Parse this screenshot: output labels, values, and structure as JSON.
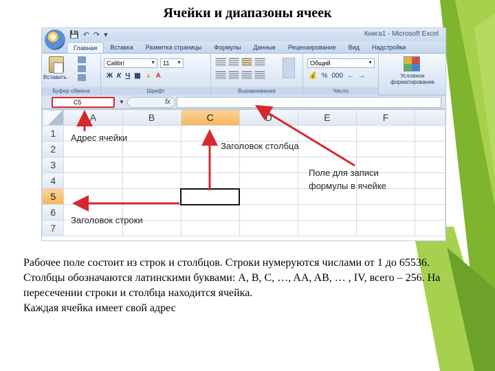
{
  "slide": {
    "title": "Ячейки и диапазоны ячеек",
    "paragraphs": [
      "Рабочее поле состоит из строк и столбцов. Строки нумеруются числами от 1 до 65536.",
      "Столбцы обозначаются латинскими буквами: A, B, C, …, AA, AB, … , IV, всего – 256. На пересечении строки и столбца находится ячейка.",
      "Каждая ячейка имеет свой адрес"
    ],
    "accent_colors": {
      "green_light": "#9ccc3c",
      "green_dark": "#6ea12a",
      "arrow_red": "#d7282f"
    }
  },
  "excel": {
    "window_title": "Книга1 - Microsoft Excel",
    "tabs": [
      "Главная",
      "Вставка",
      "Разметка страницы",
      "Формулы",
      "Данные",
      "Рецензирование",
      "Вид",
      "Надстройки"
    ],
    "active_tab": "Главная",
    "ribbon": {
      "clipboard": {
        "paste_label": "Вставить",
        "group_label": "Буфер обмена"
      },
      "font": {
        "font_name": "Calibri",
        "font_size": "11",
        "group_label": "Шрифт"
      },
      "alignment": {
        "group_label": "Выравнивание"
      },
      "number": {
        "format": "Общий",
        "group_label": "Число"
      },
      "styles": {
        "label": "Условное форматирование"
      }
    },
    "name_box": "C5",
    "fx_label": "fx",
    "columns": [
      "A",
      "B",
      "C",
      "D",
      "E",
      "F"
    ],
    "rows": [
      "1",
      "2",
      "3",
      "4",
      "5",
      "6",
      "7"
    ],
    "selected_cell": {
      "column": "C",
      "row": "5"
    },
    "annotations": {
      "cell_address": "Адрес ячейки",
      "column_header": "Заголовок столбца",
      "formula_field_line1": "Поле для записи",
      "formula_field_line2": "формулы в ячейке",
      "row_header": "Заголовок строки"
    }
  }
}
